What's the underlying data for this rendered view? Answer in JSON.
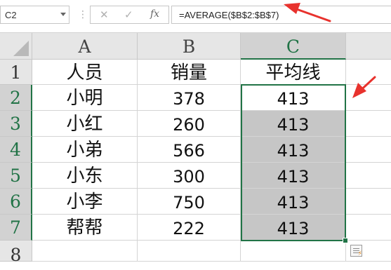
{
  "formula_bar": {
    "name_box": "C2",
    "cancel_icon": "✕",
    "enter_icon": "✓",
    "fx_label": "fx",
    "separator": "⋮",
    "formula": "=AVERAGE($B$2:$B$7)"
  },
  "columns": [
    "A",
    "B",
    "C"
  ],
  "rows": [
    "1",
    "2",
    "3",
    "4",
    "5",
    "6",
    "7",
    "8"
  ],
  "cells": {
    "A1": "人员",
    "B1": "销量",
    "C1": "平均线",
    "A2": "小明",
    "B2": "378",
    "C2": "413",
    "A3": "小红",
    "B3": "260",
    "C3": "413",
    "A4": "小弟",
    "B4": "566",
    "C4": "413",
    "A5": "小东",
    "B5": "300",
    "C5": "413",
    "A6": "小李",
    "B6": "750",
    "C6": "413",
    "A7": "帮帮",
    "B7": "222",
    "C7": "413"
  },
  "colors": {
    "selection_green": "#217346",
    "annotation_red": "#e8322d",
    "selected_fill": "#c6c6c6",
    "header_bg": "#e6e6e6"
  },
  "icons": {
    "quick_analysis_bolt": "⚡"
  }
}
